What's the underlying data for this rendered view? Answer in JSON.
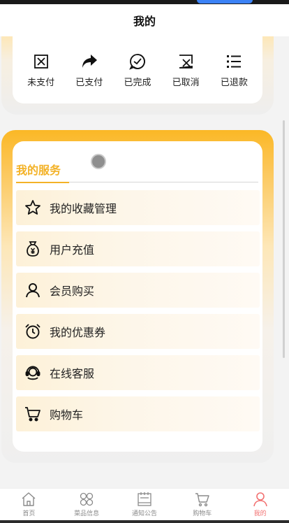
{
  "header": {
    "title": "我的"
  },
  "orders": [
    {
      "label": "未支付",
      "icon": "unpaid-icon"
    },
    {
      "label": "已支付",
      "icon": "paid-share-icon"
    },
    {
      "label": "已完成",
      "icon": "completed-icon"
    },
    {
      "label": "已取消",
      "icon": "cancelled-icon"
    },
    {
      "label": "已退款",
      "icon": "refund-list-icon"
    }
  ],
  "services": {
    "title": "我的服务",
    "items": [
      {
        "label": "我的收藏管理",
        "icon": "star-icon"
      },
      {
        "label": "用户充值",
        "icon": "money-bag-icon"
      },
      {
        "label": "会员购买",
        "icon": "user-icon"
      },
      {
        "label": "我的优惠券",
        "icon": "alarm-clock-icon"
      },
      {
        "label": "在线客服",
        "icon": "headset-icon"
      },
      {
        "label": "购物车",
        "icon": "cart-icon"
      }
    ]
  },
  "tabbar": {
    "items": [
      {
        "label": "首页",
        "icon": "home-icon"
      },
      {
        "label": "菜品信息",
        "icon": "grid-icon"
      },
      {
        "label": "通知公告",
        "icon": "notice-icon"
      },
      {
        "label": "购物车",
        "icon": "cart-icon"
      },
      {
        "label": "我的",
        "icon": "profile-icon",
        "active": true
      }
    ]
  },
  "colors": {
    "accent": "#f3b227",
    "active_tab": "#f27171",
    "panel_gradient_top": "#fbb826"
  }
}
